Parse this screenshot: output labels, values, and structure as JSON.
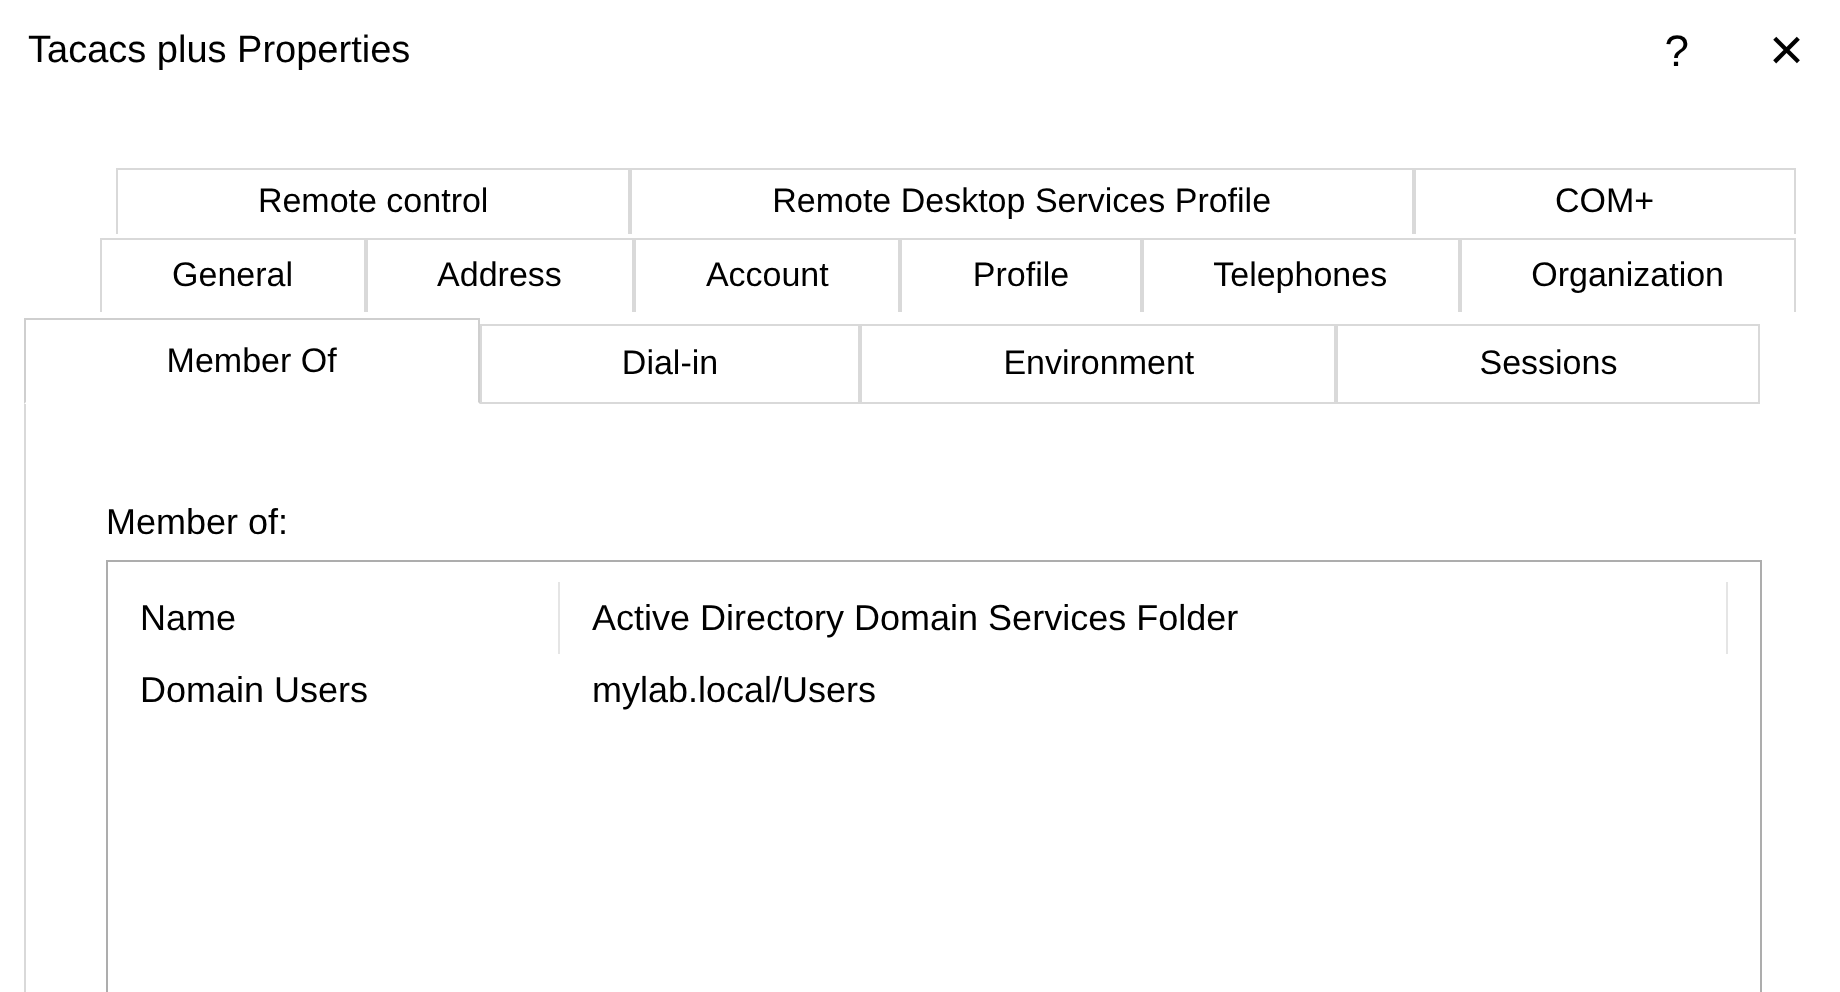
{
  "window": {
    "title": "Tacacs plus Properties",
    "help": "?",
    "close": "×"
  },
  "tab_rows": [
    [
      {
        "label": "Remote control",
        "selected": false
      },
      {
        "label": "Remote Desktop Services Profile",
        "selected": false
      },
      {
        "label": "COM+",
        "selected": false
      }
    ],
    [
      {
        "label": "General",
        "selected": false
      },
      {
        "label": "Address",
        "selected": false
      },
      {
        "label": "Account",
        "selected": false
      },
      {
        "label": "Profile",
        "selected": false
      },
      {
        "label": "Telephones",
        "selected": false
      },
      {
        "label": "Organization",
        "selected": false
      }
    ],
    [
      {
        "label": "Member Of",
        "selected": true
      },
      {
        "label": "Dial-in",
        "selected": false
      },
      {
        "label": "Environment",
        "selected": false
      },
      {
        "label": "Sessions",
        "selected": false
      }
    ]
  ],
  "section_label": "Member of:",
  "list": {
    "columns": [
      "Name",
      "Active Directory Domain Services Folder"
    ],
    "rows": [
      [
        "Domain Users",
        "mylab.local/Users"
      ]
    ]
  }
}
